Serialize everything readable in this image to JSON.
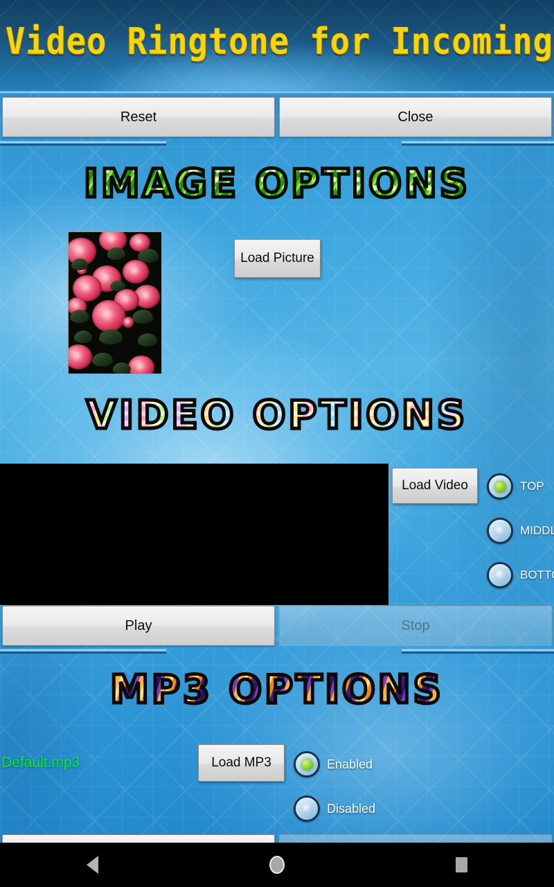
{
  "app": {
    "title": "Video Ringtone for Incoming Call"
  },
  "topbar": {
    "reset_label": "Reset",
    "close_label": "Close"
  },
  "sections": {
    "image": {
      "heading": "IMAGE OPTIONS",
      "load_picture_label": "Load Picture",
      "thumbnail_alt": "roses-thumbnail"
    },
    "video": {
      "heading": "VIDEO OPTIONS",
      "load_video_label": "Load Video",
      "position_options": [
        {
          "label": "TOP",
          "selected": true
        },
        {
          "label": "MIDDLE",
          "selected": false
        },
        {
          "label": "BOTTOM",
          "selected": false
        }
      ],
      "play_label": "Play",
      "stop_label": "Stop",
      "stop_disabled": true
    },
    "mp3": {
      "heading": "MP3 OPTIONS",
      "file_name": "Default.mp3",
      "load_mp3_label": "Load MP3",
      "state_options": [
        {
          "label": "Enabled",
          "selected": true
        },
        {
          "label": "Disabled",
          "selected": false
        }
      ]
    }
  },
  "navbar": {
    "back": "back-icon",
    "home": "home-icon",
    "recents": "recents-icon"
  },
  "colors": {
    "title_yellow": "#f5d414",
    "mp3_file_green": "#09e83a",
    "radio_selected_green": "#74c513",
    "background_blue": "#3ba3dd",
    "header_navy": "#17496f"
  }
}
